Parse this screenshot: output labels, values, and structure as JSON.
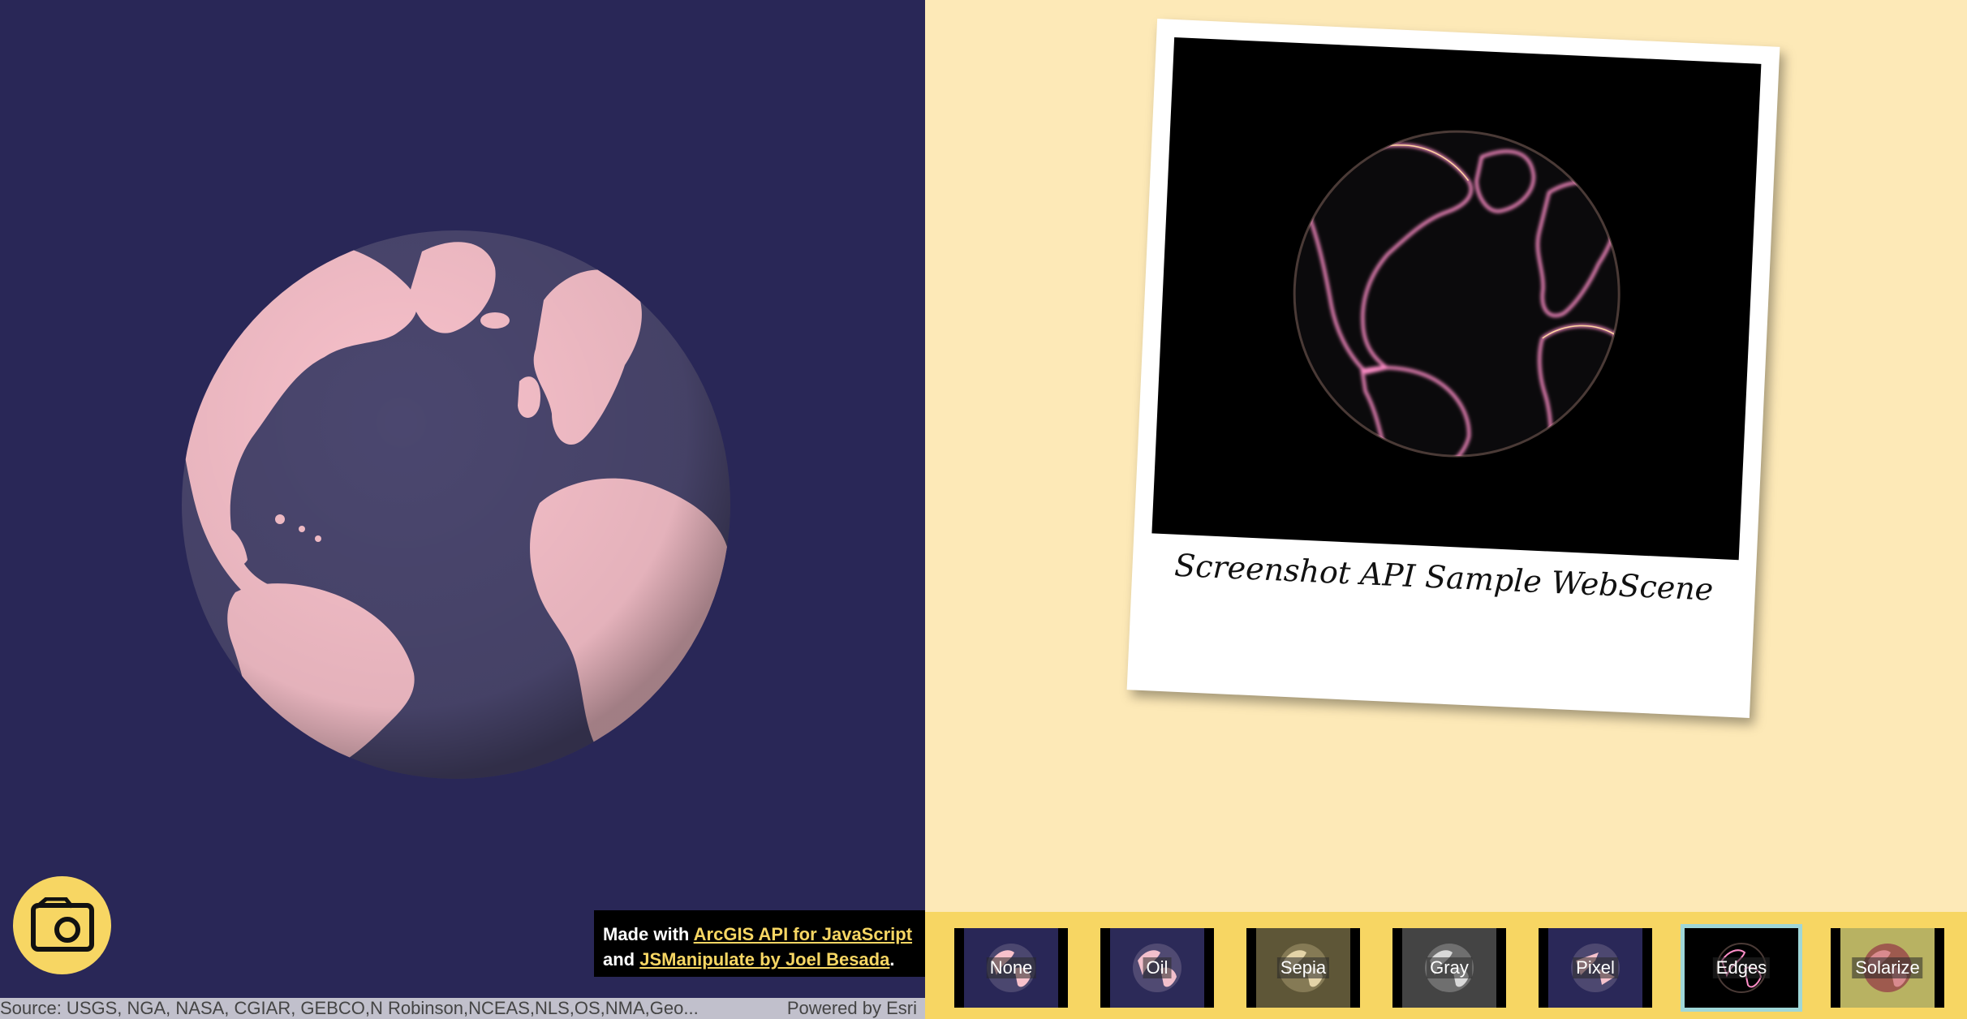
{
  "credits": {
    "made_with": "Made with ",
    "link1": "ArcGIS API for JavaScript",
    "and": "and ",
    "link2": "JSManipulate by Joel Besada",
    "period": "."
  },
  "attribution": {
    "source": "Source: USGS, NGA, NASA, CGIAR, GEBCO,N Robinson,NCEAS,NLS,OS,NMA,Geo...",
    "powered": "Powered by Esri"
  },
  "polaroid": {
    "caption": "Screenshot API Sample WebScene"
  },
  "filters": [
    {
      "label": "None",
      "active": false
    },
    {
      "label": "Oil",
      "active": false
    },
    {
      "label": "Sepia",
      "active": false
    },
    {
      "label": "Gray",
      "active": false
    },
    {
      "label": "Pixel",
      "active": false
    },
    {
      "label": "Edges",
      "active": true
    },
    {
      "label": "Solarize",
      "active": false
    }
  ],
  "colors": {
    "scene_background": "#292757",
    "land": "#f8c1cb",
    "ocean_globe": "#4b476f",
    "accent": "#f7d663",
    "page_background": "#fde9b7"
  },
  "icons": {
    "camera": "camera-icon"
  }
}
